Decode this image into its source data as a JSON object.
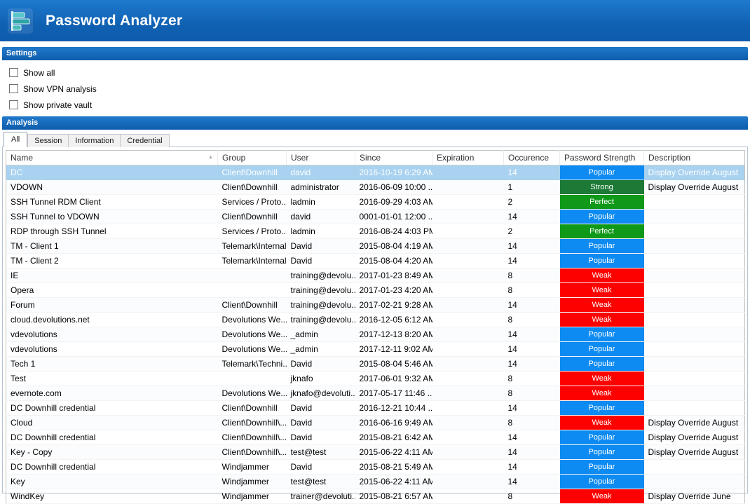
{
  "app": {
    "title": "Password Analyzer"
  },
  "settings": {
    "header": "Settings",
    "checkboxes": [
      {
        "label": "Show all",
        "checked": false
      },
      {
        "label": "Show VPN analysis",
        "checked": false
      },
      {
        "label": "Show private vault",
        "checked": false
      }
    ]
  },
  "analysis": {
    "header": "Analysis",
    "tabs": [
      {
        "label": "All",
        "active": true
      },
      {
        "label": "Session",
        "active": false
      },
      {
        "label": "Information",
        "active": false
      },
      {
        "label": "Credential",
        "active": false
      }
    ],
    "table": {
      "columns": [
        "Name",
        "Group",
        "User",
        "Since",
        "Expiration",
        "Occurence",
        "Password Strength",
        "Description"
      ],
      "sort_column": "Name",
      "sort_direction": "ascending",
      "rows": [
        {
          "name": "DC",
          "group": "Client\\Downhill",
          "user": "david",
          "since": "2016-10-19 6:29 AM",
          "expiration": "",
          "occurence": 14,
          "strength": "Popular",
          "description": "Display Override August",
          "selected": true
        },
        {
          "name": "VDOWN",
          "group": "Client\\Downhill",
          "user": "administrator",
          "since": "2016-06-09 10:00 ...",
          "expiration": "",
          "occurence": 1,
          "strength": "Strong",
          "description": "Display Override August",
          "selected": false
        },
        {
          "name": "SSH Tunnel RDM Client",
          "group": "Services / Proto...",
          "user": "ladmin",
          "since": "2016-09-29 4:03 AM",
          "expiration": "",
          "occurence": 2,
          "strength": "Perfect",
          "description": "",
          "selected": false
        },
        {
          "name": "SSH Tunnel to VDOWN",
          "group": "Client\\Downhill",
          "user": "david",
          "since": "0001-01-01 12:00 ...",
          "expiration": "",
          "occurence": 14,
          "strength": "Popular",
          "description": "",
          "selected": false
        },
        {
          "name": "RDP through SSH Tunnel",
          "group": "Services / Proto...",
          "user": "ladmin",
          "since": "2016-08-24 4:03 PM",
          "expiration": "",
          "occurence": 2,
          "strength": "Perfect",
          "description": "",
          "selected": false
        },
        {
          "name": "TM - Client 1",
          "group": "Telemark\\Internal",
          "user": "David",
          "since": "2015-08-04 4:19 AM",
          "expiration": "",
          "occurence": 14,
          "strength": "Popular",
          "description": "",
          "selected": false
        },
        {
          "name": "TM - Client 2",
          "group": "Telemark\\Internal",
          "user": "David",
          "since": "2015-08-04 4:20 AM",
          "expiration": "",
          "occurence": 14,
          "strength": "Popular",
          "description": "",
          "selected": false
        },
        {
          "name": "IE",
          "group": "",
          "user": "training@devolu...",
          "since": "2017-01-23 8:49 AM",
          "expiration": "",
          "occurence": 8,
          "strength": "Weak",
          "description": "",
          "selected": false
        },
        {
          "name": "Opera",
          "group": "",
          "user": "training@devolu...",
          "since": "2017-01-23 4:20 AM",
          "expiration": "",
          "occurence": 8,
          "strength": "Weak",
          "description": "",
          "selected": false
        },
        {
          "name": "Forum",
          "group": "Client\\Downhill",
          "user": "training@devolu...",
          "since": "2017-02-21 9:28 AM",
          "expiration": "",
          "occurence": 14,
          "strength": "Weak",
          "description": "",
          "selected": false
        },
        {
          "name": "cloud.devolutions.net",
          "group": "Devolutions We...",
          "user": "training@devolu...",
          "since": "2016-12-05 6:12 AM",
          "expiration": "",
          "occurence": 8,
          "strength": "Weak",
          "description": "",
          "selected": false
        },
        {
          "name": "vdevolutions",
          "group": "Devolutions We...",
          "user": "_admin",
          "since": "2017-12-13 8:20 AM",
          "expiration": "",
          "occurence": 14,
          "strength": "Popular",
          "description": "",
          "selected": false
        },
        {
          "name": "vdevolutions",
          "group": "Devolutions We...",
          "user": "_admin",
          "since": "2017-12-11 9:02 AM",
          "expiration": "",
          "occurence": 14,
          "strength": "Popular",
          "description": "",
          "selected": false
        },
        {
          "name": "Tech 1",
          "group": "Telemark\\Techni...",
          "user": "David",
          "since": "2015-08-04 5:46 AM",
          "expiration": "",
          "occurence": 14,
          "strength": "Popular",
          "description": "",
          "selected": false
        },
        {
          "name": "Test",
          "group": "",
          "user": "jknafo",
          "since": "2017-06-01 9:32 AM",
          "expiration": "",
          "occurence": 8,
          "strength": "Weak",
          "description": "",
          "selected": false
        },
        {
          "name": "evernote.com",
          "group": "Devolutions We...",
          "user": "jknafo@devoluti...",
          "since": "2017-05-17 11:46 ...",
          "expiration": "",
          "occurence": 8,
          "strength": "Weak",
          "description": "",
          "selected": false
        },
        {
          "name": "DC Downhill credential",
          "group": "Client\\Downhill",
          "user": "David",
          "since": "2016-12-21 10:44 ...",
          "expiration": "",
          "occurence": 14,
          "strength": "Popular",
          "description": "",
          "selected": false
        },
        {
          "name": "Cloud",
          "group": "Client\\Downhill\\...",
          "user": "David",
          "since": "2016-06-16 9:49 AM",
          "expiration": "",
          "occurence": 8,
          "strength": "Weak",
          "description": "Display Override August",
          "selected": false
        },
        {
          "name": "DC Downhill credential",
          "group": "Client\\Downhill\\...",
          "user": "David",
          "since": "2015-08-21 6:42 AM",
          "expiration": "",
          "occurence": 14,
          "strength": "Popular",
          "description": "Display Override August",
          "selected": false
        },
        {
          "name": "Key - Copy",
          "group": "Client\\Downhill\\...",
          "user": "test@test",
          "since": "2015-06-22 4:11 AM",
          "expiration": "",
          "occurence": 14,
          "strength": "Popular",
          "description": "Display Override August",
          "selected": false
        },
        {
          "name": "DC Downhill credential",
          "group": "Windjammer",
          "user": "David",
          "since": "2015-08-21 5:49 AM",
          "expiration": "",
          "occurence": 14,
          "strength": "Popular",
          "description": "",
          "selected": false
        },
        {
          "name": "Key",
          "group": "Windjammer",
          "user": "test@test",
          "since": "2015-06-22 4:11 AM",
          "expiration": "",
          "occurence": 14,
          "strength": "Popular",
          "description": "",
          "selected": false
        },
        {
          "name": "WindKey",
          "group": "Windjammer",
          "user": "trainer@devoluti...",
          "since": "2015-08-21 6:57 AM",
          "expiration": "",
          "occurence": 8,
          "strength": "Weak",
          "description": "Display Override June",
          "selected": false
        }
      ]
    }
  },
  "colors": {
    "header_bar": "#1166b8",
    "selected_row": "#a9d2f0",
    "strength": {
      "Popular": "#0d8bf2",
      "Strong": "#1d7a36",
      "Perfect": "#109919",
      "Weak": "#fd0000"
    }
  },
  "icons": {
    "app_icon": "bar-chart-icon",
    "sort_ascending": "▲"
  }
}
